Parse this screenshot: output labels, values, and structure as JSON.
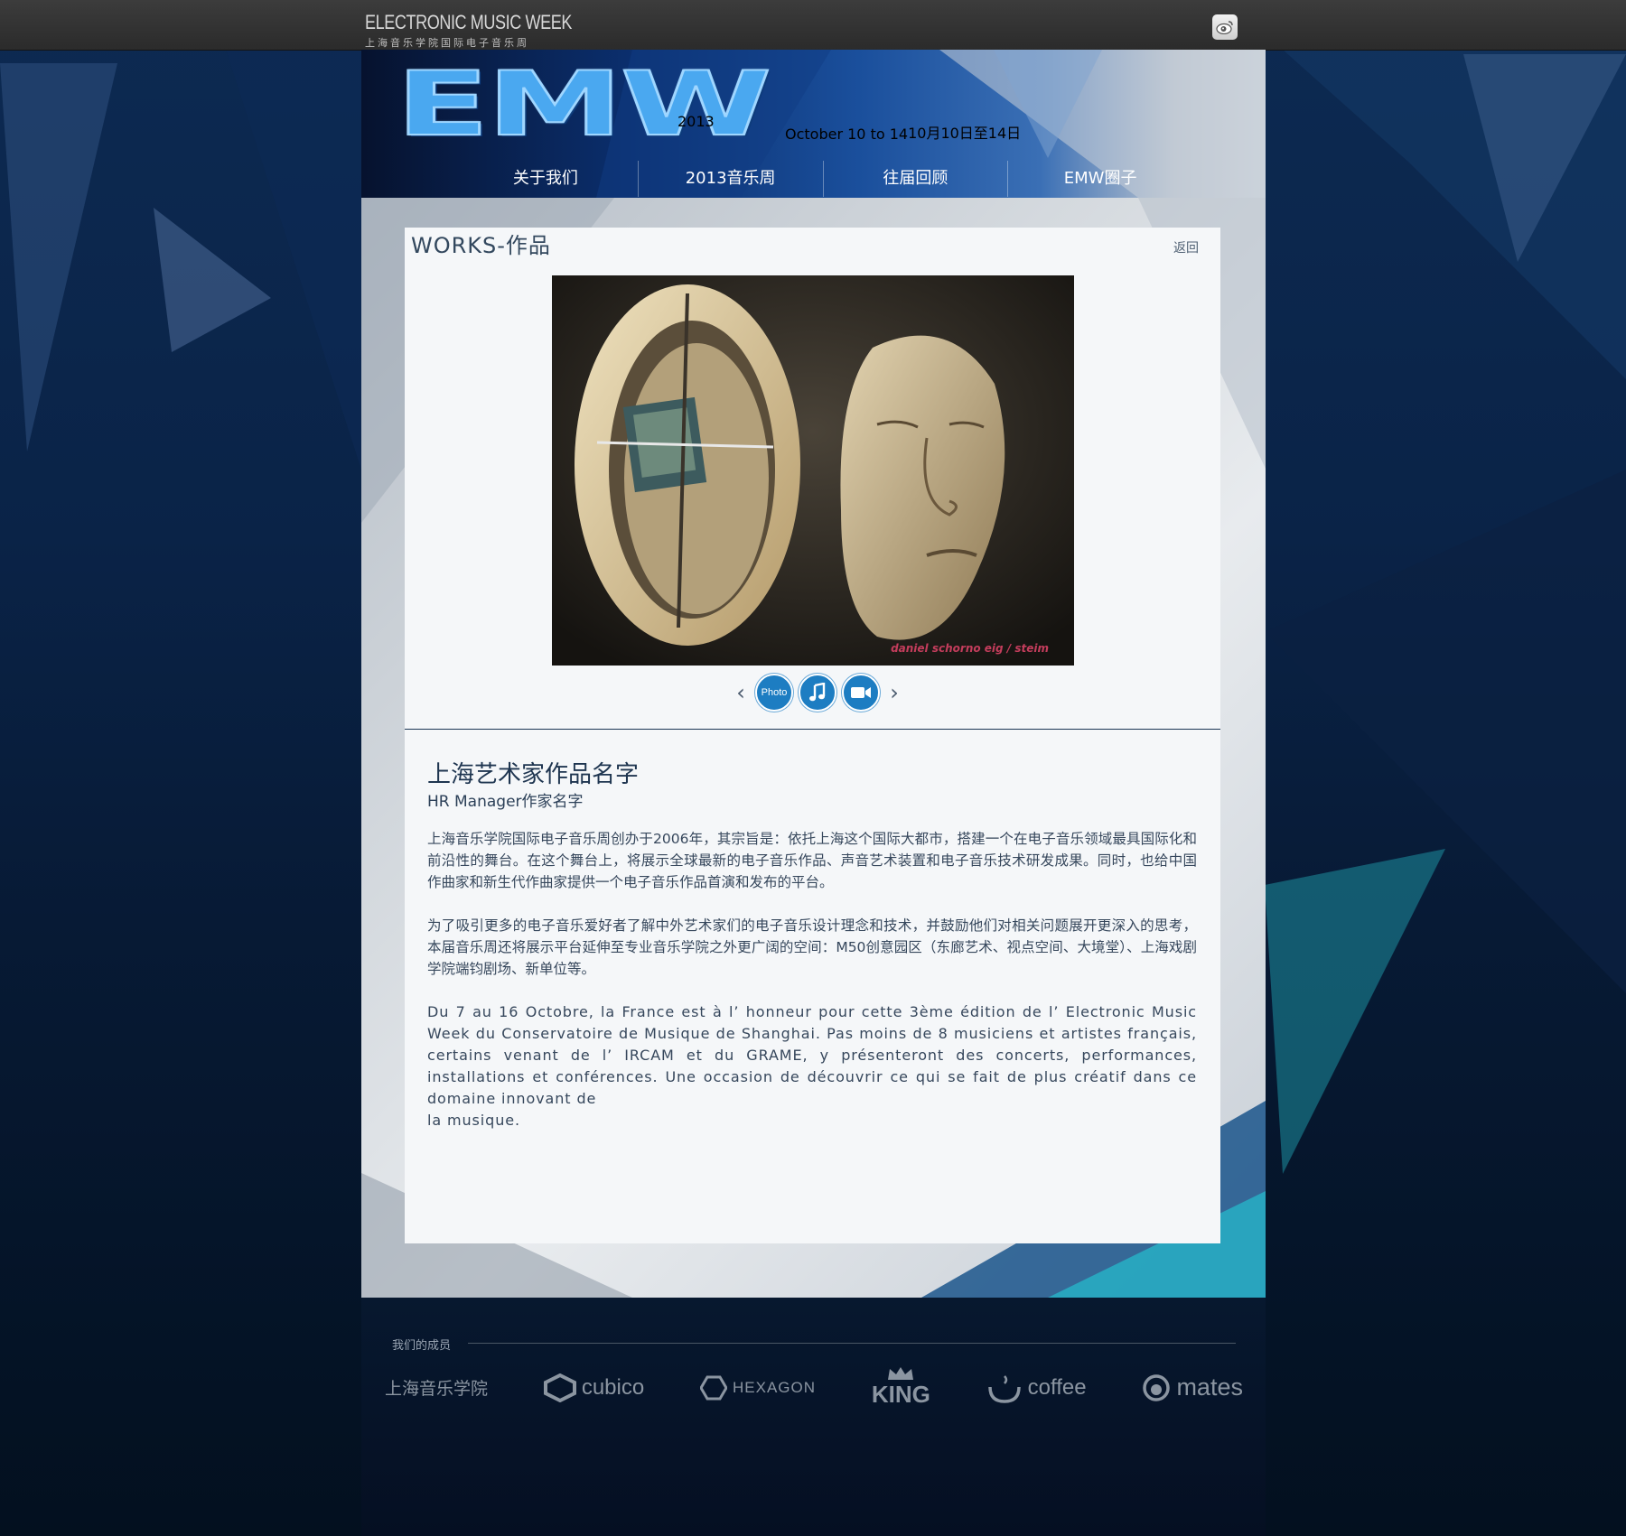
{
  "topbar": {
    "brand_en": "ELECTRONIC MUSIC WEEK",
    "brand_cn": "上海音乐学院国际电子音乐周",
    "weibo_icon": "weibo-icon"
  },
  "header": {
    "logo_text": "EMW",
    "year": "2013",
    "dates_en": "October 10 to 14",
    "dates_cn": "10月10日至14日"
  },
  "nav": {
    "items": [
      {
        "label": "关于我们"
      },
      {
        "label": "2013音乐周"
      },
      {
        "label": "往届回顾"
      },
      {
        "label": "EMW圈子"
      }
    ]
  },
  "works": {
    "section_title": "WORKS-作品",
    "back_label": "返回",
    "photo_caption": "daniel schorno eig / steim",
    "media_buttons": {
      "photo_label": "Photo",
      "music_icon": "music-note-icon",
      "video_icon": "video-camera-icon",
      "prev_icon": "chevron-left-icon",
      "next_icon": "chevron-right-icon"
    },
    "title": "上海艺术家作品名字",
    "author": "HR Manager作家名字",
    "paragraphs": [
      "上海音乐学院国际电子音乐周创办于2006年，其宗旨是：依托上海这个国际大都市，搭建一个在电子音乐领域最具国际化和前沿性的舞台。在这个舞台上，将展示全球最新的电子音乐作品、声音艺术装置和电子音乐技术研发成果。同时，也给中国作曲家和新生代作曲家提供一个电子音乐作品首演和发布的平台。",
      "为了吸引更多的电子音乐爱好者了解中外艺术家们的电子音乐设计理念和技术，并鼓励他们对相关问题展开更深入的思考，本届音乐周还将展示平台延伸至专业音乐学院之外更广阔的空间：M50创意园区（东廊艺术、视点空间、大境堂）、上海戏剧学院端钧剧场、新单位等。",
      "Du 7 au 16 Octobre, la France est à l’ honneur pour cette 3ème édition de l’ Electronic Music Week du Conservatoire de Musique de Shanghai. Pas moins de 8 musiciens et artistes français, certains venant de l’ IRCAM et du GRAME, y présenteront des concerts, performances, installations et conférences. Une occasion de découvrir ce qui se fait de plus créatif dans ce domaine innovant de",
      " la musique."
    ]
  },
  "footer": {
    "members_label": "我们的成员",
    "sponsors": [
      {
        "name": "上海音乐学院"
      },
      {
        "name": "cubico"
      },
      {
        "name": "HEXAGON"
      },
      {
        "name": "KING"
      },
      {
        "name": "coffee"
      },
      {
        "name": "mates"
      }
    ]
  },
  "colors": {
    "accent_blue": "#1d7dc2",
    "topbar": "#2f2f2f",
    "panel_bg": "#f5f7f9"
  }
}
